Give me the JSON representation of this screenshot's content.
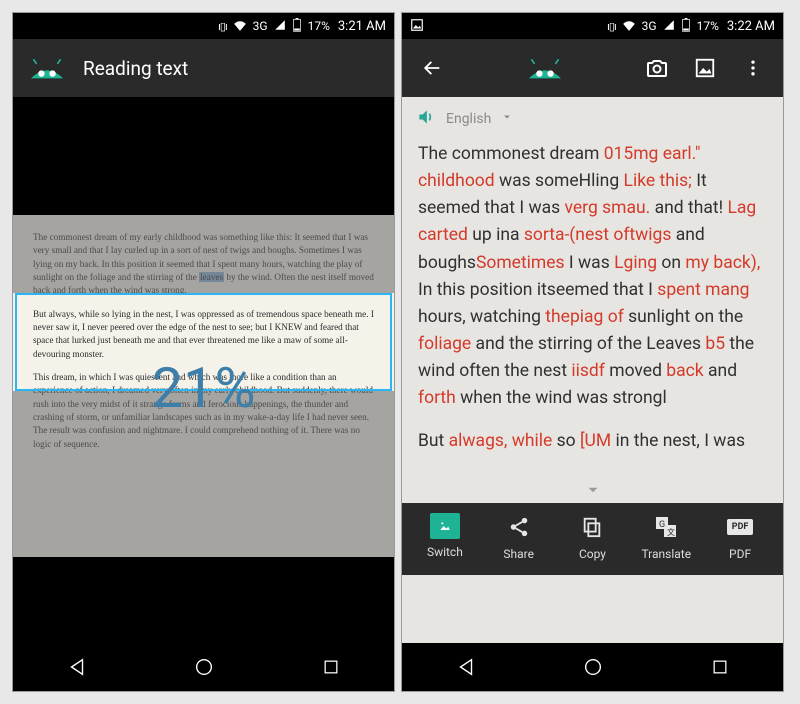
{
  "left": {
    "status": {
      "network": "3G",
      "battery_pct": "17%",
      "time": "3:21 AM"
    },
    "appbar_title": "Reading text",
    "progress_pct": "21%",
    "document": {
      "p1_a": "The commonest dream of my early childhood was something like this: It seemed that I was very small and that I lay curled up in a sort of nest of twigs and boughs. Sometimes I was lying on my back. In this position it seemed that I spent many hours, watching the play of sunlight on the foliage and the stirring of the ",
      "p1_hl": "leaves",
      "p1_b": " by the wind. Often the nest itself moved back and forth when the wind was strong.",
      "p2": "But always, while so lying in the nest, I was oppressed as of tremendous space beneath me. I never saw it, I never peered over the edge of the nest to see; but I KNEW and feared that space that lurked just beneath me and that ever threatened me like a maw of some all-devouring monster.",
      "p3": "This dream, in which I was quiescent and which was more like a condition than an experience of action, I dreamed very often in my early childhood. But suddenly, there would rush into the very midst of it strange forms and ferocious happenings, the thunder and crashing of storm, or unfamiliar landscapes such as in my wake-a-day life I had never seen. The result was confusion and nightmare. I could comprehend nothing of it. There was no logic of sequence."
    }
  },
  "right": {
    "status": {
      "network": "3G",
      "battery_pct": "17%",
      "time": "3:22 AM"
    },
    "language": "English",
    "result": {
      "segments": [
        {
          "t": "The commonest dream "
        },
        {
          "t": "015mg earl.\"",
          "e": 1
        },
        {
          "t": " "
        },
        {
          "t": "childhood",
          "e": 1
        },
        {
          "t": " was someHling "
        },
        {
          "t": "Like this;",
          "e": 1
        },
        {
          "t": " It seemed that I was "
        },
        {
          "t": "verg smau.",
          "e": 1
        },
        {
          "t": " and that! "
        },
        {
          "t": "Lag carted",
          "e": 1
        },
        {
          "t": " up ina "
        },
        {
          "t": "sorta-(nest oftwigs",
          "e": 1
        },
        {
          "t": " and boughs"
        },
        {
          "t": "Sometimes",
          "e": 1
        },
        {
          "t": " I was "
        },
        {
          "t": "Lging",
          "e": 1
        },
        {
          "t": " on "
        },
        {
          "t": "my back),",
          "e": 1
        },
        {
          "t": " In this position itseemed that I "
        },
        {
          "t": "spent mang",
          "e": 1
        },
        {
          "t": " hours, watching "
        },
        {
          "t": "thepiag of",
          "e": 1
        },
        {
          "t": " sunlight on the "
        },
        {
          "t": "foliage",
          "e": 1
        },
        {
          "t": " and the stirring of the Leaves "
        },
        {
          "t": "b5",
          "e": 1
        },
        {
          "t": " the wind often the nest "
        },
        {
          "t": "iisdf",
          "e": 1
        },
        {
          "t": " moved "
        },
        {
          "t": "back",
          "e": 1
        },
        {
          "t": " and "
        },
        {
          "t": "forth",
          "e": 1
        },
        {
          "t": " when the wind was strongl"
        }
      ],
      "p2_segments": [
        {
          "t": "But "
        },
        {
          "t": "alwags, while",
          "e": 1
        },
        {
          "t": " so "
        },
        {
          "t": "[UM",
          "e": 1
        },
        {
          "t": " in the nest, I was"
        }
      ]
    },
    "tools": {
      "switch": "Switch",
      "share": "Share",
      "copy": "Copy",
      "translate": "Translate",
      "pdf": "PDF",
      "pdf_badge": "PDF"
    }
  }
}
